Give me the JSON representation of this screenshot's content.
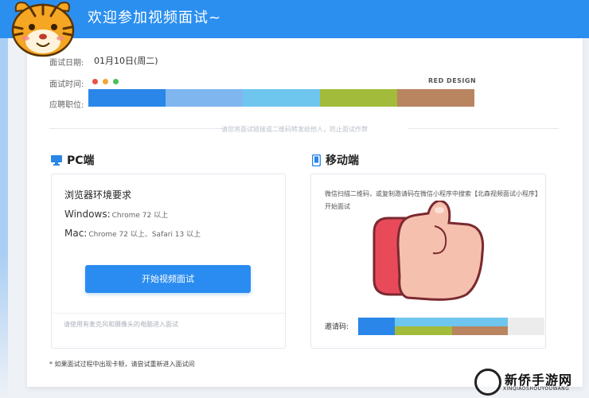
{
  "header": {
    "title": "欢迎参加视频面试~",
    "brand_color": "#2b8ff0"
  },
  "info": {
    "date_label": "面试日期:",
    "date_value": "01月10日(周二)",
    "time_label": "面试时间:",
    "position_label": "应聘职位:",
    "window_dot_colors": [
      "#e8524a",
      "#f2a735",
      "#4cbf5a"
    ],
    "design_label": "RED DESIGN",
    "palette": [
      "#2a86e8",
      "#7fb6f0",
      "#6ec6ef",
      "#a2bb3a",
      "#b98460"
    ]
  },
  "top_hint": "请您将面试链接或二维码转发给他人，防止面试作弊",
  "pc": {
    "icon": "monitor-icon",
    "title": "PC端",
    "heading": "浏览器环境要求",
    "requirements": [
      {
        "label": "Windows:",
        "value": "Chrome 72 以上"
      },
      {
        "label": "Mac:",
        "value": "Chrome 72 以上、Safari 13 以上"
      }
    ],
    "start_button": "开始视频面试",
    "tip": "请使用有麦克风和摄像头的电脑进入面试"
  },
  "mobile": {
    "icon": "phone-icon",
    "title": "移动端",
    "description": "微信扫描二维码，或复制邀请码在微信小程序中搜索【北森视频面试小程序】开始面试",
    "invite_label": "邀请码:",
    "invite_colors": [
      "#2a86e8",
      "#6ec6ef",
      "#a2bb3a",
      "#b98460",
      "#ececec"
    ]
  },
  "footnote": "* 如果面试过程中出现卡顿，请尝试重新进入面试间",
  "watermark": {
    "title": "新侨手游网",
    "subtitle": "XINQIAOSHOUYOUWANG"
  }
}
